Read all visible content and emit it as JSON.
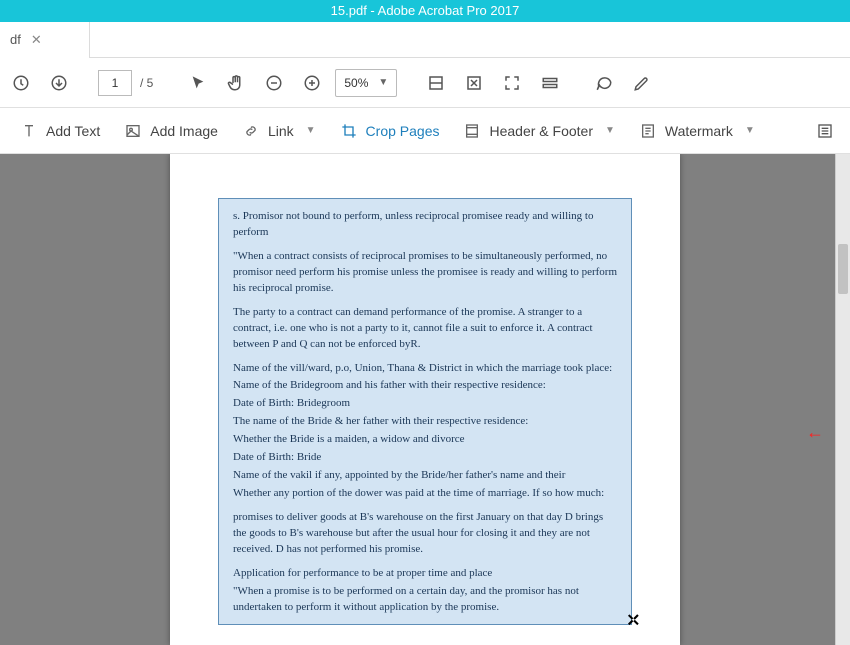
{
  "window": {
    "title": "15.pdf - Adobe Acrobat Pro 2017"
  },
  "tabs": [
    {
      "label": "df"
    }
  ],
  "pager": {
    "current": "1",
    "total": "/ 5"
  },
  "zoom": {
    "value": "50%"
  },
  "edit_toolbar": {
    "add_text": "Add Text",
    "add_image": "Add Image",
    "link": "Link",
    "crop_pages": "Crop Pages",
    "header_footer": "Header & Footer",
    "watermark": "Watermark"
  },
  "document": {
    "paragraphs": [
      "s. Promisor not bound to perform, unless reciprocal promisee ready and willing to perform",
      "\"When a contract consists of reciprocal promises to be simultaneously performed, no promisor need perform his promise unless the promisee is ready and willing to perform his reciprocal promise.",
      "The party to a contract can demand performance of the promise. A stranger to a contract, i.e. one who is not a party to it, cannot file a suit to enforce it. A contract between P and Q can not be enforced byR.",
      "Name of the vill/ward, p.o, Union, Thana & District in which the marriage took place:",
      "Name of the Bridegroom and his father with their respective residence:",
      "Date of Birth: Bridegroom",
      "The name of the Bride & her father with their respective residence:",
      "Whether the Bride is a maiden, a widow and divorce",
      "Date of Birth: Bride",
      "Name of the vakil if any, appointed by the Bride/her father's name and their",
      "Whether any portion of the dower was paid at the time of marriage. If so how much:",
      "promises to deliver goods at B's warehouse on the first January on that day D brings the goods to B's warehouse but after the usual hour for closing it and they are not received. D has not performed his promise.",
      "Application for performance to be at proper time and place",
      "\"When a promise is to be performed on a certain day, and the promisor has not undertaken to perform it without application by the promise."
    ]
  }
}
